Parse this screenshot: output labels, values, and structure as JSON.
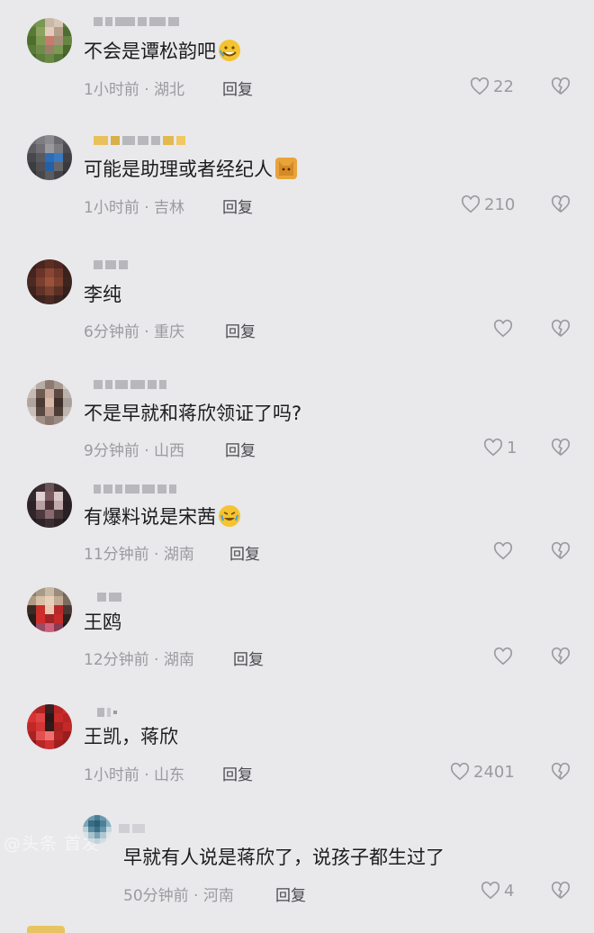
{
  "comments": [
    {
      "text": "不会是谭松韵吧",
      "emoji": "rofl-emoji",
      "meta": "1小时前 · 湖北",
      "reply": "回复",
      "likes": "22"
    },
    {
      "text": "可能是助理或者经纪人",
      "emoji": "cat-emoji",
      "meta": "1小时前 · 吉林",
      "reply": "回复",
      "likes": "210"
    },
    {
      "text": "李纯",
      "meta": "6分钟前 · 重庆",
      "reply": "回复",
      "likes": ""
    },
    {
      "text": "不是早就和蒋欣领证了吗?",
      "meta": "9分钟前 · 山西",
      "reply": "回复",
      "likes": "1"
    },
    {
      "text": "有爆料说是宋茜",
      "emoji": "crying-laughing-emoji",
      "meta": "11分钟前 · 湖南",
      "reply": "回复",
      "likes": ""
    },
    {
      "text": "王鸥",
      "meta": "12分钟前 · 湖南",
      "reply": "回复",
      "likes": ""
    },
    {
      "text": "王凯，蒋欣",
      "meta": "1小时前 · 山东",
      "reply": "回复",
      "likes": "2401"
    },
    {
      "text": "早就有人说是蒋欣了，说孩子都生过了",
      "meta": "50分钟前 · 河南",
      "reply": "回复",
      "likes": "4"
    }
  ],
  "watermark": "@头条 首发"
}
